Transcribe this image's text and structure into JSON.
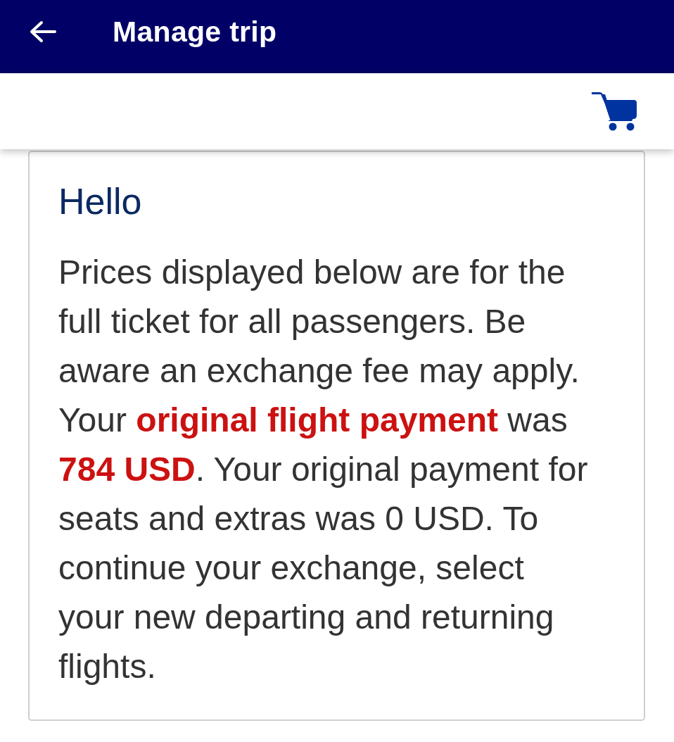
{
  "app_bar": {
    "title": "Manage trip"
  },
  "notice_card": {
    "heading": "Hello",
    "body": "Prices displayed below are for the full ticket for all passengers. Be aware an exchange fee may apply. Your **original flight payment** was **784 USD**. Your original payment for seats and extras was 0 USD. To continue your exchange, select your new departing and returning flights."
  }
}
